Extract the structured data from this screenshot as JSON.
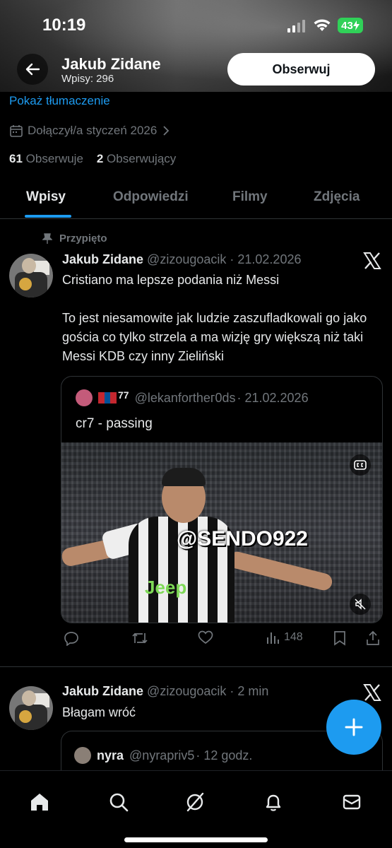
{
  "status_bar": {
    "time": "10:19",
    "battery": "43"
  },
  "header": {
    "name": "Jakub Zidane",
    "post_count": "Wpisy: 296",
    "follow_label": "Obserwuj"
  },
  "profile": {
    "translate_label": "Pokaż tłumaczenie",
    "joined": "Dołączył/a styczeń 2026",
    "following_count": "61",
    "following_label": "Obserwuje",
    "followers_count": "2",
    "followers_label": "Obserwujący"
  },
  "tabs": [
    {
      "label": "Wpisy",
      "active": true
    },
    {
      "label": "Odpowiedzi",
      "active": false
    },
    {
      "label": "Filmy",
      "active": false
    },
    {
      "label": "Zdjęcia",
      "active": false
    }
  ],
  "post1": {
    "pinned_label": "Przypięto",
    "author": "Jakub Zidane",
    "handle": "@zizougoacik",
    "time": "· 21.02.2026",
    "text_line1": "Cristiano ma lepsze podania niż Messi",
    "text_line2": "To jest niesamowite jak ludzie zaszufladkowali go jako gościa co tylko strzela a ma wizję gry większą niż taki Messi KDB czy inny Zieliński",
    "quote": {
      "name_suffix": "77",
      "handle": "@lekanforthег0ds",
      "time": "· 21.02.2026",
      "text": "cr7 - passing",
      "watermark": "@SENDO922",
      "jersey_text": "Jeep"
    },
    "views": "148"
  },
  "post2": {
    "author": "Jakub Zidane",
    "handle": "@zizougoacik",
    "time": "· 2 min",
    "text": "Błagam wróć",
    "quote": {
      "author": "nyra",
      "handle": "@nyrapriv5",
      "time": "· 12 godz."
    }
  },
  "colors": {
    "accent": "#1d9bf0",
    "background": "#000000",
    "muted": "#71767b",
    "text": "#e7e9ea"
  }
}
